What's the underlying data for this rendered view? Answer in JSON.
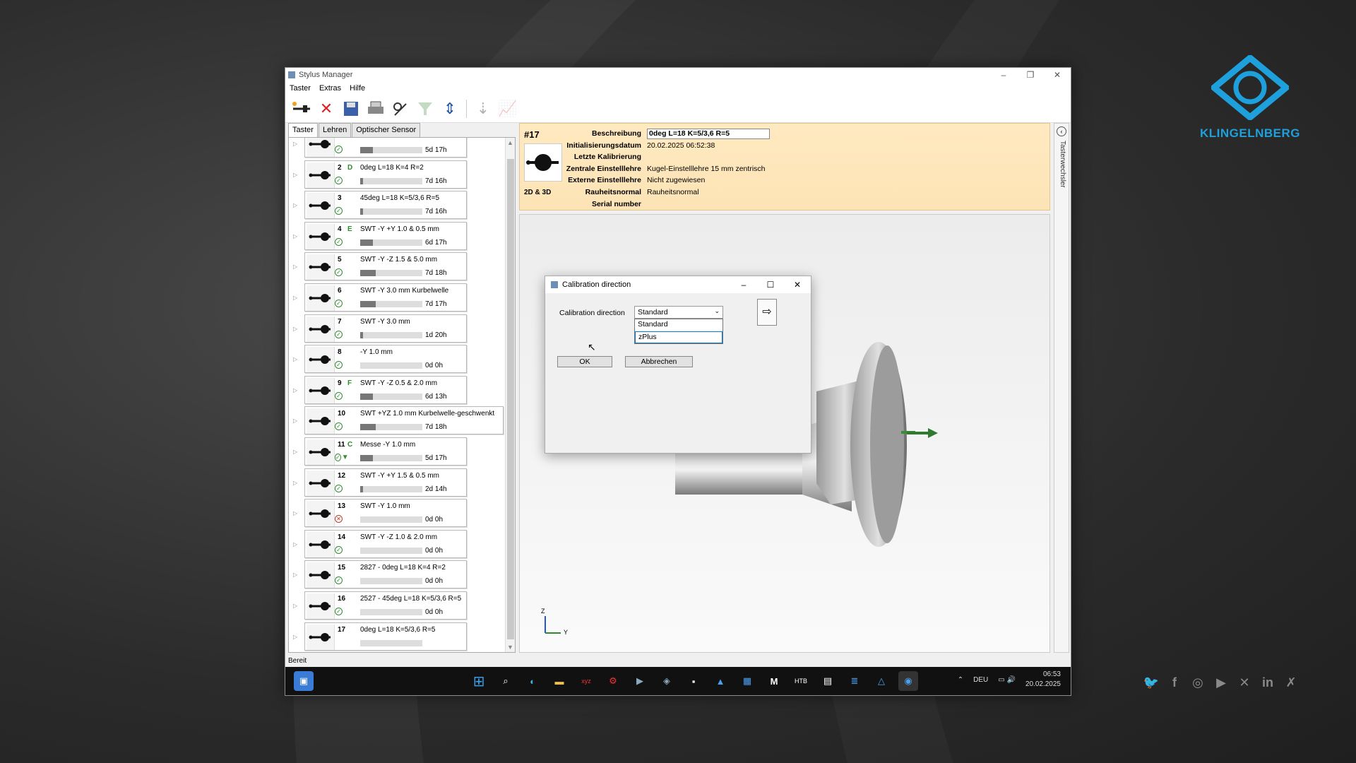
{
  "brand": {
    "name": "KLINGELNBERG",
    "accent": "#1ea0dc"
  },
  "window": {
    "title": "Stylus Manager",
    "controls": [
      "–",
      "❐",
      "✕"
    ]
  },
  "menu": [
    "Taster",
    "Extras",
    "Hilfe"
  ],
  "toolbar": [
    "stylus-add-icon",
    "delete-icon",
    "save-icon",
    "print-icon",
    "calibrate-icon",
    "filter-icon",
    "sort-icon",
    "import-icon",
    "chart-icon"
  ],
  "tabs": [
    "Taster",
    "Lehren",
    "Optischer Sensor"
  ],
  "list": [
    {
      "num": "",
      "letter": "",
      "name": "",
      "age": "5d 17h",
      "fill": 0.2,
      "status": "ok"
    },
    {
      "num": "2",
      "letter": "D",
      "name": "0deg L=18 K=4 R=2",
      "age": "7d 16h",
      "fill": 0.05,
      "status": "ok"
    },
    {
      "num": "3",
      "letter": "",
      "name": "45deg L=18 K=5/3,6 R=5",
      "age": "7d 16h",
      "fill": 0.05,
      "status": "ok"
    },
    {
      "num": "4",
      "letter": "E",
      "name": "SWT -Y +Y 1.0 & 0.5 mm",
      "age": "6d 17h",
      "fill": 0.2,
      "status": "ok"
    },
    {
      "num": "5",
      "letter": "",
      "name": "SWT -Y -Z 1.5 & 5.0 mm",
      "age": "7d 18h",
      "fill": 0.25,
      "status": "ok"
    },
    {
      "num": "6",
      "letter": "",
      "name": "SWT -Y 3.0 mm Kurbelwelle",
      "age": "7d 17h",
      "fill": 0.25,
      "status": "ok"
    },
    {
      "num": "7",
      "letter": "",
      "name": "SWT -Y 3.0 mm",
      "age": "1d 20h",
      "fill": 0.05,
      "status": "ok"
    },
    {
      "num": "8",
      "letter": "",
      "name": "-Y 1.0 mm",
      "age": "0d 0h",
      "fill": 0.0,
      "status": "ok"
    },
    {
      "num": "9",
      "letter": "F",
      "name": "SWT -Y -Z 0.5 & 2.0 mm",
      "age": "6d 13h",
      "fill": 0.2,
      "status": "ok"
    },
    {
      "num": "10",
      "letter": "",
      "name": "SWT +YZ 1.0 mm Kurbelwelle-geschwenkt",
      "age": "7d 18h",
      "fill": 0.25,
      "status": "ok",
      "wide": true
    },
    {
      "num": "11",
      "letter": "C",
      "name": "Messe -Y 1.0 mm",
      "age": "5d 17h",
      "fill": 0.2,
      "status": "ok2"
    },
    {
      "num": "12",
      "letter": "",
      "name": "SWT -Y +Y 1.5 & 0.5 mm",
      "age": "2d 14h",
      "fill": 0.05,
      "status": "ok"
    },
    {
      "num": "13",
      "letter": "",
      "name": "SWT -Y 1.0 mm",
      "age": "0d 0h",
      "fill": 0.0,
      "status": "err"
    },
    {
      "num": "14",
      "letter": "",
      "name": "SWT -Y -Z 1.0 & 2.0 mm",
      "age": "0d 0h",
      "fill": 0.0,
      "status": "ok"
    },
    {
      "num": "15",
      "letter": "",
      "name": "2827 - 0deg L=18 K=4 R=2",
      "age": "0d 0h",
      "fill": 0.0,
      "status": "ok"
    },
    {
      "num": "16",
      "letter": "",
      "name": "2527 - 45deg L=18 K=5/3,6 R=5",
      "age": "0d 0h",
      "fill": 0.0,
      "status": "ok"
    },
    {
      "num": "17",
      "letter": "",
      "name": "0deg L=18 K=5/3,6 R=5",
      "age": "",
      "fill": 0.0,
      "status": "none"
    }
  ],
  "info": {
    "id": "#17",
    "mode": "2D & 3D",
    "labels": [
      "Beschreibung",
      "Initialisierungsdatum",
      "Letzte Kalibrierung",
      "Zentrale Einstelllehre",
      "Externe Einstelllehre",
      "Rauheitsnormal",
      "Serial number"
    ],
    "description": "0deg L=18 K=5/3,6 R=5",
    "init_date": "20.02.2025 06:52:38",
    "last_cal": "",
    "central": "Kugel-Einstelllehre 15 mm zentrisch",
    "external": "Nicht zugewiesen",
    "roughness": "Rauheitsnormal",
    "serial": ""
  },
  "side": {
    "label": "Tasterwechsler"
  },
  "axes": {
    "z": "Z",
    "y": "Y"
  },
  "status": "Bereit",
  "taskbar": {
    "lang": "DEU",
    "time": "06:53",
    "date": "20.02.2025"
  },
  "dialog": {
    "title": "Calibration direction",
    "label": "Calibration direction",
    "selected": "Standard",
    "options": [
      "Standard",
      "zPlus"
    ],
    "ok": "OK",
    "cancel": "Abbrechen"
  }
}
